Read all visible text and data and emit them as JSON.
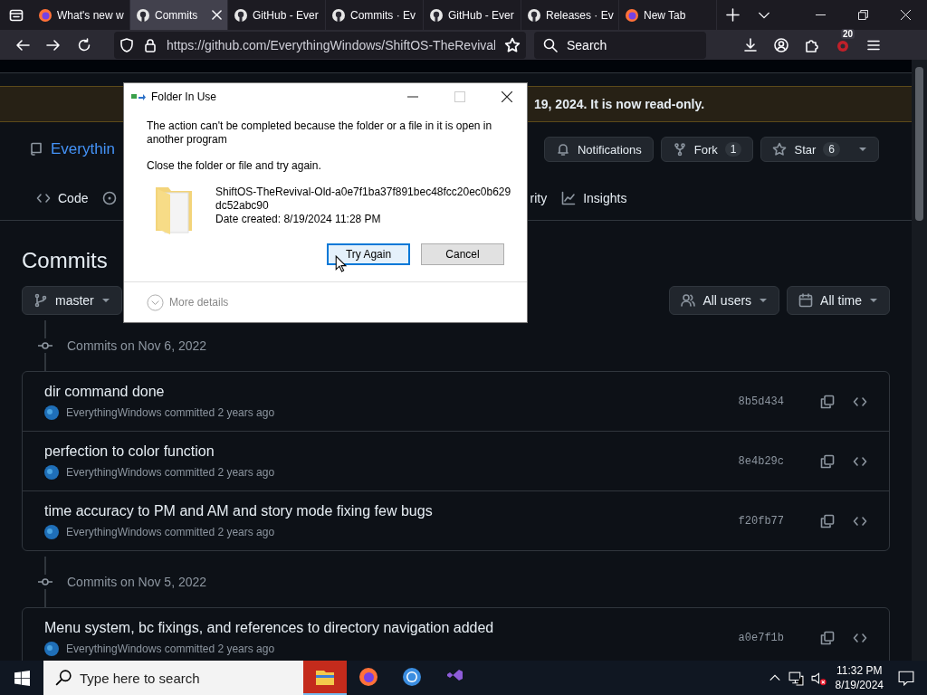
{
  "browser": {
    "tabs": [
      {
        "label": "What's new w",
        "kind": "internal",
        "selected": false
      },
      {
        "label": "Commits",
        "kind": "web",
        "selected": true
      },
      {
        "label": "GitHub - Ever",
        "kind": "web",
        "selected": false
      },
      {
        "label": "Commits · Ev",
        "kind": "web",
        "selected": false
      },
      {
        "label": "GitHub - Ever",
        "kind": "web",
        "selected": false
      },
      {
        "label": "Releases · Ev",
        "kind": "web",
        "selected": false
      },
      {
        "label": "New Tab",
        "kind": "internal",
        "selected": false
      }
    ],
    "url": "https://github.com/EverythingWindows/ShiftOS-TheRevival",
    "search": {
      "placeholder": "Search"
    },
    "extension_badge": "20"
  },
  "page": {
    "banner": "19, 2024. It is now read-only.",
    "repo_title": "Everythin",
    "repo_actions": [
      {
        "label": "Notifications"
      },
      {
        "label": "Fork",
        "count": "1"
      },
      {
        "label": "Star",
        "count": "6"
      }
    ],
    "nav_tabs": [
      {
        "label": "Code"
      },
      {
        "label": "rity"
      },
      {
        "label": "Insights"
      }
    ],
    "heading": "Commits",
    "branch": "master",
    "filters": [
      {
        "label": "All users"
      },
      {
        "label": "All time"
      }
    ],
    "groups": [
      {
        "title": "Commits on Nov 6, 2022",
        "commits": [
          {
            "message": "dir command done",
            "byline": "EverythingWindows committed 2 years ago",
            "sha": "8b5d434"
          },
          {
            "message": "perfection to color function",
            "byline": "EverythingWindows committed 2 years ago",
            "sha": "8e4b29c"
          },
          {
            "message": "time accuracy to PM and AM and story mode fixing few bugs",
            "byline": "EverythingWindows committed 2 years ago",
            "sha": "f20fb77"
          }
        ]
      },
      {
        "title": "Commits on Nov 5, 2022",
        "commits": [
          {
            "message": "Menu system, bc fixings, and references to directory navigation added",
            "byline": "EverythingWindows committed 2 years ago",
            "sha": "a0e7f1b"
          }
        ]
      }
    ]
  },
  "dialog": {
    "title": "Folder In Use",
    "message": "The action can't be completed because the folder or a file in it is open in another program",
    "instruction": "Close the folder or file and try again.",
    "file_name": "ShiftOS-TheRevival-Old-a0e7f1ba37f891bec48fcc20ec0b629dc52abc90",
    "date_created": "Date created: 8/19/2024 11:28 PM",
    "buttons": [
      {
        "label": "Try Again",
        "selected": true
      },
      {
        "label": "Cancel",
        "selected": false
      }
    ],
    "more_details": "More details"
  },
  "taskbar": {
    "search": {
      "placeholder": "Type here to search"
    },
    "apps": [
      {
        "selected": true
      },
      {
        "selected": false
      },
      {
        "selected": false
      },
      {
        "selected": false
      }
    ],
    "time": "11:32 PM",
    "date": "8/19/2024"
  }
}
